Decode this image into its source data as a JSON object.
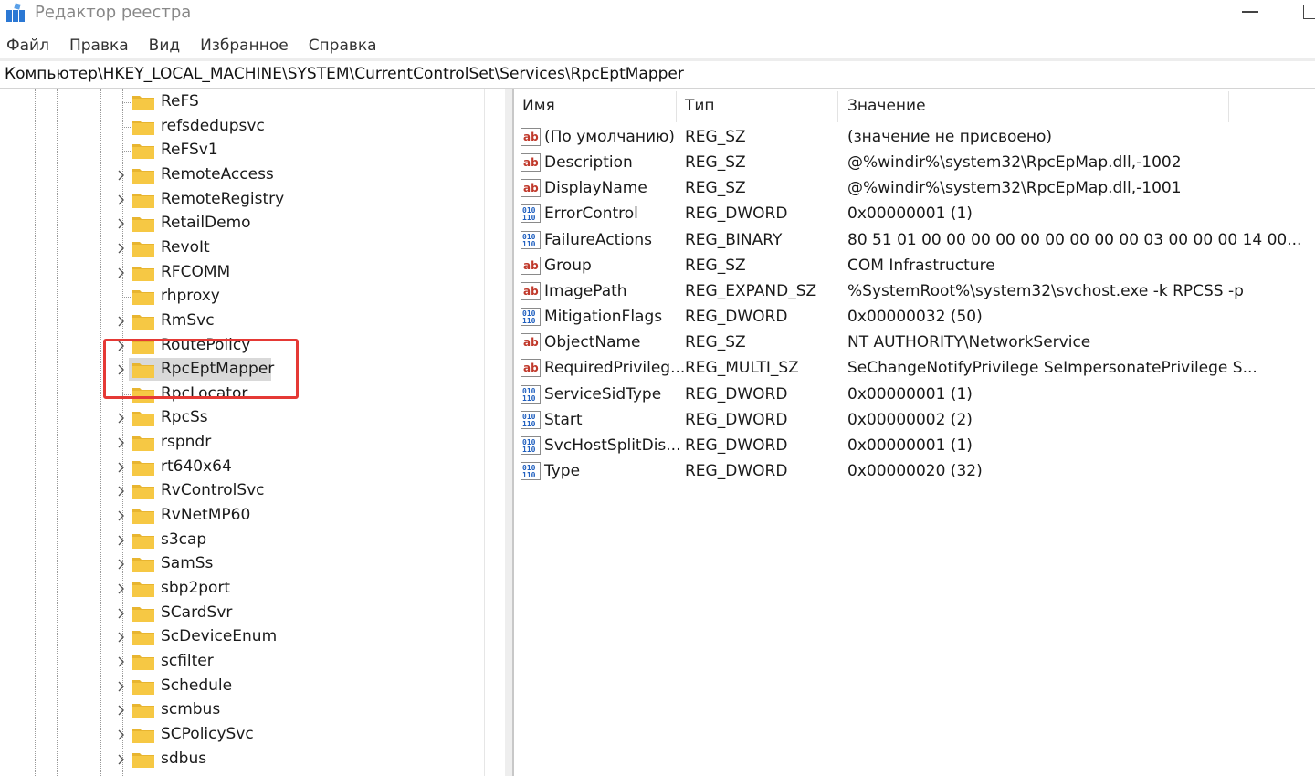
{
  "window": {
    "title": "Редактор реестра"
  },
  "menu": [
    "Файл",
    "Правка",
    "Вид",
    "Избранное",
    "Справка"
  ],
  "address": "Компьютер\\HKEY_LOCAL_MACHINE\\SYSTEM\\CurrentControlSet\\Services\\RpcEptMapper",
  "tree": {
    "selected": "RpcEptMapper",
    "nodes": [
      {
        "label": "ReFS",
        "expandable": false
      },
      {
        "label": "refsdedupsvc",
        "expandable": false
      },
      {
        "label": "ReFSv1",
        "expandable": false
      },
      {
        "label": "RemoteAccess",
        "expandable": true
      },
      {
        "label": "RemoteRegistry",
        "expandable": true
      },
      {
        "label": "RetailDemo",
        "expandable": true
      },
      {
        "label": "RevoIt",
        "expandable": true
      },
      {
        "label": "RFCOMM",
        "expandable": true
      },
      {
        "label": "rhproxy",
        "expandable": false
      },
      {
        "label": "RmSvc",
        "expandable": true
      },
      {
        "label": "RoutePolicy",
        "expandable": true
      },
      {
        "label": "RpcEptMapper",
        "expandable": true
      },
      {
        "label": "RpcLocator",
        "expandable": false
      },
      {
        "label": "RpcSs",
        "expandable": true
      },
      {
        "label": "rspndr",
        "expandable": true
      },
      {
        "label": "rt640x64",
        "expandable": true
      },
      {
        "label": "RvControlSvc",
        "expandable": true
      },
      {
        "label": "RvNetMP60",
        "expandable": true
      },
      {
        "label": "s3cap",
        "expandable": true
      },
      {
        "label": "SamSs",
        "expandable": true
      },
      {
        "label": "sbp2port",
        "expandable": true
      },
      {
        "label": "SCardSvr",
        "expandable": true
      },
      {
        "label": "ScDeviceEnum",
        "expandable": true
      },
      {
        "label": "scfilter",
        "expandable": true
      },
      {
        "label": "Schedule",
        "expandable": true
      },
      {
        "label": "scmbus",
        "expandable": true
      },
      {
        "label": "SCPolicySvc",
        "expandable": true
      },
      {
        "label": "sdbus",
        "expandable": true
      }
    ]
  },
  "values": {
    "headers": {
      "name": "Имя",
      "type": "Тип",
      "data": "Значение"
    },
    "rows": [
      {
        "icon": "string-value-icon",
        "name": "(По умолчанию)",
        "type": "REG_SZ",
        "data": "(значение не присвоено)"
      },
      {
        "icon": "string-value-icon",
        "name": "Description",
        "type": "REG_SZ",
        "data": "@%windir%\\system32\\RpcEpMap.dll,-1002"
      },
      {
        "icon": "string-value-icon",
        "name": "DisplayName",
        "type": "REG_SZ",
        "data": "@%windir%\\system32\\RpcEpMap.dll,-1001"
      },
      {
        "icon": "binary-value-icon",
        "name": "ErrorControl",
        "type": "REG_DWORD",
        "data": "0x00000001 (1)"
      },
      {
        "icon": "binary-value-icon",
        "name": "FailureActions",
        "type": "REG_BINARY",
        "data": "80 51 01 00 00 00 00 00 00 00 00 00 03 00 00 00 14 00..."
      },
      {
        "icon": "string-value-icon",
        "name": "Group",
        "type": "REG_SZ",
        "data": "COM Infrastructure"
      },
      {
        "icon": "string-value-icon",
        "name": "ImagePath",
        "type": "REG_EXPAND_SZ",
        "data": "%SystemRoot%\\system32\\svchost.exe -k RPCSS -p"
      },
      {
        "icon": "binary-value-icon",
        "name": "MitigationFlags",
        "type": "REG_DWORD",
        "data": "0x00000032 (50)"
      },
      {
        "icon": "string-value-icon",
        "name": "ObjectName",
        "type": "REG_SZ",
        "data": "NT AUTHORITY\\NetworkService"
      },
      {
        "icon": "string-value-icon",
        "name": "RequiredPrivileg...",
        "type": "REG_MULTI_SZ",
        "data": "SeChangeNotifyPrivilege SeImpersonatePrivilege S..."
      },
      {
        "icon": "binary-value-icon",
        "name": "ServiceSidType",
        "type": "REG_DWORD",
        "data": "0x00000001 (1)"
      },
      {
        "icon": "binary-value-icon",
        "name": "Start",
        "type": "REG_DWORD",
        "data": "0x00000002 (2)"
      },
      {
        "icon": "binary-value-icon",
        "name": "SvcHostSplitDis...",
        "type": "REG_DWORD",
        "data": "0x00000001 (1)"
      },
      {
        "icon": "binary-value-icon",
        "name": "Type",
        "type": "REG_DWORD",
        "data": "0x00000020 (32)"
      }
    ]
  },
  "colors": {
    "folder": "#f4c542",
    "highlight": "#e53935",
    "selection": "#d9d9d9",
    "string_icon": "#c0392b",
    "binary_icon": "#1f5fbf"
  }
}
